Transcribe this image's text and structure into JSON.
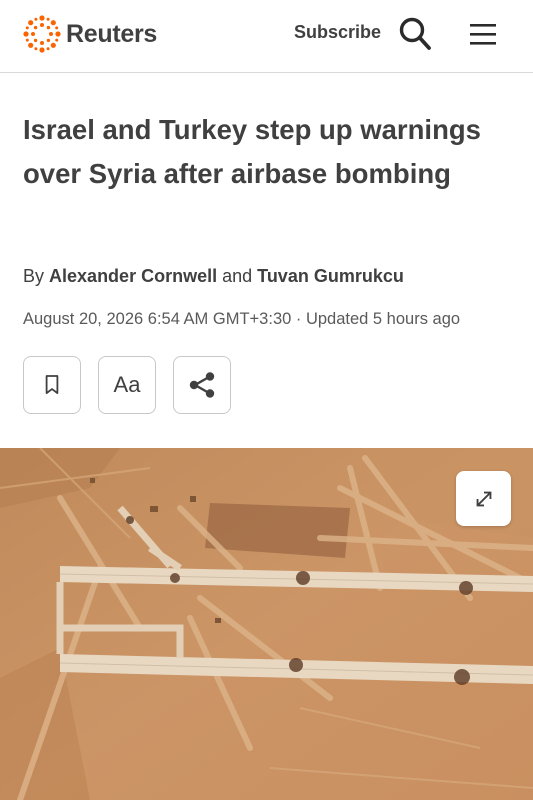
{
  "header": {
    "logo_text": "Reuters",
    "subscribe_label": "Subscribe",
    "search_icon": "search-icon",
    "menu_icon": "hamburger-menu-icon",
    "brand_color": "#fa6400"
  },
  "article": {
    "headline": "Israel and Turkey step up warnings over Syria after airbase bombing",
    "byline_prefix": "By",
    "author_1": "Alexander Cornwell",
    "byline_join": "and",
    "author_2": "Tuvan Gumrukcu",
    "dateline": "August 20, 2026 6:54 AM GMT+3:30 · Updated 5 hours ago"
  },
  "actions": {
    "bookmark_icon": "bookmark-icon",
    "text_size_label": "Aa",
    "share_icon": "share-icon"
  },
  "hero": {
    "image_subject": "satellite image of airbase runways",
    "expand_icon": "expand-icon"
  }
}
